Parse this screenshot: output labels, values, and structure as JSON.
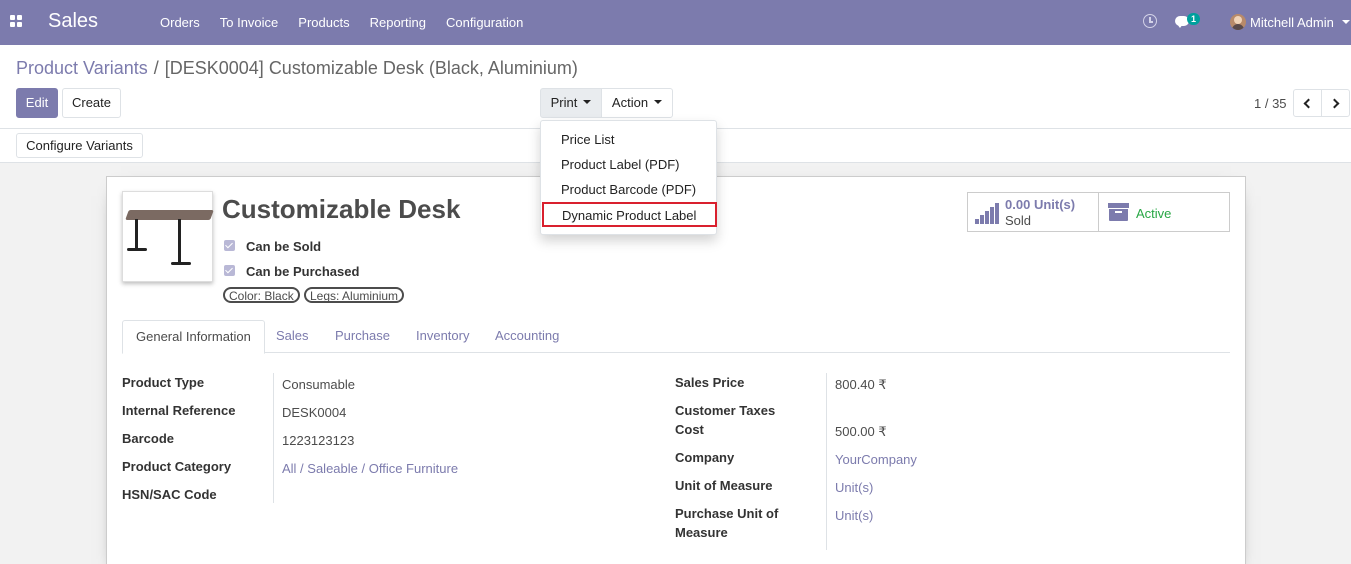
{
  "navbar": {
    "brand": "Sales",
    "menu": [
      "Orders",
      "To Invoice",
      "Products",
      "Reporting",
      "Configuration"
    ],
    "chat_badge": "1",
    "user_name": "Mitchell Admin",
    "accent_color": "#7c7bad"
  },
  "breadcrumb": {
    "parent": "Product Variants",
    "separator": "/",
    "current": "[DESK0004] Customizable Desk (Black, Aluminium)"
  },
  "toolbar": {
    "edit_label": "Edit",
    "create_label": "Create",
    "print_label": "Print",
    "action_label": "Action",
    "pager": "1 / 35",
    "configure_label": "Configure Variants"
  },
  "print_menu": {
    "items": [
      "Price List",
      "Product Label (PDF)",
      "Product Barcode (PDF)",
      "Dynamic Product Label"
    ],
    "highlighted_index": 3,
    "highlight_color": "#d9202e"
  },
  "product": {
    "name": "Customizable Desk",
    "can_be_sold_label": "Can be Sold",
    "can_be_sold": true,
    "can_be_purchased_label": "Can be Purchased",
    "can_be_purchased": true,
    "tags": [
      "Color: Black",
      "Legs: Aluminium"
    ]
  },
  "smart_buttons": {
    "sold_value": "0.00",
    "sold_unit": "Unit(s)",
    "sold_label": "Sold",
    "active_label": "Active",
    "active_color": "#28a745"
  },
  "tabs": [
    "General Information",
    "Sales",
    "Purchase",
    "Inventory",
    "Accounting"
  ],
  "active_tab": "General Information",
  "left_fields": [
    {
      "label": "Product Type",
      "value": "Consumable",
      "link": false
    },
    {
      "label": "Internal Reference",
      "value": "DESK0004",
      "link": false
    },
    {
      "label": "Barcode",
      "value": "1223123123",
      "link": false
    },
    {
      "label": "Product Category",
      "value": "All / Saleable / Office Furniture",
      "link": true
    },
    {
      "label": "HSN/SAC Code",
      "value": "",
      "link": false
    }
  ],
  "right_fields": [
    {
      "label": "Sales Price",
      "value": "800.40 ₹",
      "link": false
    },
    {
      "label": "Customer Taxes",
      "value": "",
      "link": false
    },
    {
      "label": "Cost",
      "value": "500.00 ₹",
      "link": false
    },
    {
      "label": "Company",
      "value": "YourCompany",
      "link": true
    },
    {
      "label": "Unit of Measure",
      "value": "Unit(s)",
      "link": true
    },
    {
      "label": "Purchase Unit of Measure",
      "value": "Unit(s)",
      "link": true
    }
  ]
}
